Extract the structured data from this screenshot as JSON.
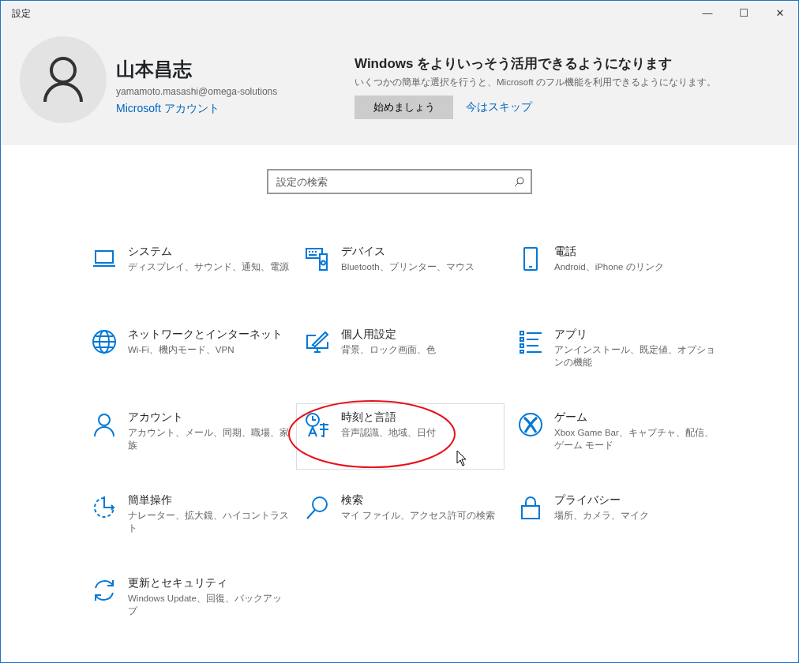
{
  "window": {
    "title": "設定",
    "controls": [
      "—",
      "☐",
      "✕"
    ]
  },
  "account": {
    "name": "山本昌志",
    "email": "yamamoto.masashi@omega-solutions",
    "link": "Microsoft アカウント"
  },
  "promo": {
    "title": "Windows をよりいっそう活用できるようになります",
    "text": "いくつかの簡単な選択を行うと、Microsoft のフル機能を利用できるようになります。",
    "primary_button": "始めましょう",
    "skip_link": "今はスキップ"
  },
  "search": {
    "placeholder": "設定の検索"
  },
  "tiles": [
    {
      "title": "システム",
      "description": "ディスプレイ、サウンド、通知、電源",
      "hovered": false,
      "circled": false
    },
    {
      "title": "デバイス",
      "description": "Bluetooth、プリンター、マウス",
      "hovered": false,
      "circled": false
    },
    {
      "title": "電話",
      "description": "Android、iPhone のリンク",
      "hovered": false,
      "circled": false
    },
    {
      "title": "ネットワークとインターネット",
      "description": "Wi-Fi、機内モード、VPN",
      "hovered": false,
      "circled": false
    },
    {
      "title": "個人用設定",
      "description": "背景、ロック画面、色",
      "hovered": false,
      "circled": false
    },
    {
      "title": "アプリ",
      "description": "アンインストール、既定値、オプションの機能",
      "hovered": false,
      "circled": false
    },
    {
      "title": "アカウント",
      "description": "アカウント、メール、同期、職場、家族",
      "hovered": false,
      "circled": false
    },
    {
      "title": "時刻と言語",
      "description": "音声認識、地域、日付",
      "hovered": true,
      "circled": true
    },
    {
      "title": "ゲーム",
      "description": "Xbox Game Bar、キャプチャ、配信、ゲーム モード",
      "hovered": false,
      "circled": false
    },
    {
      "title": "簡単操作",
      "description": "ナレーター、拡大鏡、ハイコントラスト",
      "hovered": false,
      "circled": false
    },
    {
      "title": "検索",
      "description": "マイ ファイル、アクセス許可の検索",
      "hovered": false,
      "circled": false
    },
    {
      "title": "プライバシー",
      "description": "場所、カメラ、マイク",
      "hovered": false,
      "circled": false
    },
    {
      "title": "更新とセキュリティ",
      "description": "Windows Update、回復、バックアップ",
      "hovered": false,
      "circled": false
    }
  ]
}
